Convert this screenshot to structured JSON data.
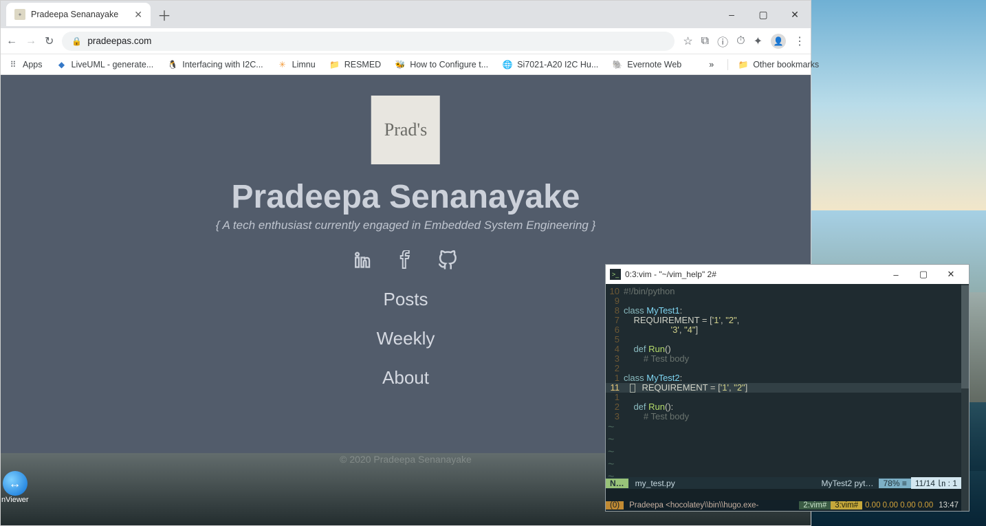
{
  "browser": {
    "tab_title": "Pradeepa Senanayake",
    "url": "pradeepas.com",
    "window_controls": {
      "min": "–",
      "max": "▢",
      "close": "✕"
    },
    "nav": {
      "back": "←",
      "forward": "→",
      "reload": "↻"
    },
    "omnibar_icons": {
      "star": "☆",
      "reader": "⧉",
      "info": "ⓘ",
      "timer": "⏱",
      "ext": "✦",
      "menu": "⋮"
    },
    "bookmarks": [
      {
        "icon": "⠿",
        "label": "Apps",
        "color": "#5f6368"
      },
      {
        "icon": "◆",
        "label": "LiveUML - generate...",
        "color": "#3478c7"
      },
      {
        "icon": "🐧",
        "label": "Interfacing with I2C...",
        "color": "#000"
      },
      {
        "icon": "✳",
        "label": "Limnu",
        "color": "#f29a3a"
      },
      {
        "icon": "📁",
        "label": "RESMED",
        "color": "#f2c24b"
      },
      {
        "icon": "🐝",
        "label": "How to Configure t...",
        "color": "#000"
      },
      {
        "icon": "🌐",
        "label": "Si7021-A20 I2C Hu...",
        "color": "#5f6368"
      },
      {
        "icon": "🐘",
        "label": "Evernote Web",
        "color": "#4bae4f"
      }
    ],
    "bookmark_overflow": "»",
    "other_bookmarks": "Other bookmarks"
  },
  "site": {
    "logo_text": "Prad's",
    "title": "Pradeepa Senanayake",
    "subtitle": "{ A tech enthusiast currently engaged in Embedded System Engineering }",
    "menu": [
      "Posts",
      "Weekly",
      "About"
    ],
    "footer": "© 2020 Pradeepa Senanayake"
  },
  "terminal": {
    "title": "0:3:vim - \"~/vim_help\" 2#",
    "lines": [
      {
        "g": "10",
        "plain": "#!/bin/python",
        "class": "cmt"
      },
      {
        "g": "9",
        "plain": "",
        "class": ""
      },
      {
        "g": "8",
        "raw": "<span class='kw'>class</span> <span class='cls'>MyTest1</span><span class='op'>:</span>"
      },
      {
        "g": "7",
        "raw": "    <span class='id'>REQUIREMENT</span> <span class='op'>=</span> <span class='op'>[</span><span class='str'>'1'</span>, <span class='str'>\"2\"</span>,"
      },
      {
        "g": "6",
        "raw": "                   <span class='str'>'3'</span>, <span class='str'>\"4\"</span><span class='op'>]</span>"
      },
      {
        "g": "5",
        "plain": "",
        "class": ""
      },
      {
        "g": "4",
        "raw": "    <span class='kw'>def</span> <span class='fn'>Run</span><span class='op'>()</span>"
      },
      {
        "g": "3",
        "raw": "        <span class='cmt'># Test body</span>"
      },
      {
        "g": "2",
        "plain": "",
        "class": ""
      },
      {
        "g": "1",
        "raw": "<span class='kw'>class</span> <span class='cls'>MyTest2</span><span class='op'>:</span>"
      },
      {
        "g": "11",
        "raw": "  <span class='cursor-box'></span>  <span class='id'>REQUIREMENT</span> <span class='op'>=</span> <span class='op'>[</span><span class='str'>'1'</span>, <span class='str'>\"2\"</span><span class='op'>]</span>",
        "cur": true
      },
      {
        "g": "1",
        "plain": "",
        "class": ""
      },
      {
        "g": "2",
        "raw": "    <span class='kw'>def</span> <span class='fn'>Run</span><span class='op'>():</span>"
      },
      {
        "g": "3",
        "raw": "        <span class='cmt'># Test body</span>"
      }
    ],
    "status": {
      "mode": "N…",
      "file": "my_test.py",
      "tag": "MyTest2  pyt…",
      "pct": "78% ≡",
      "pos": "11/14 ㏑ :  1"
    },
    "bottom": {
      "left": "(0)",
      "text": "Pradeepa <hocolatey\\\\bin\\\\hugo.exe-",
      "t2": "2:vim#",
      "t3": "3:vim#",
      "load": "0.00 0.00 0.00 0.00",
      "time": "13:47"
    }
  },
  "desktop": {
    "tv_label": "nViewer"
  }
}
